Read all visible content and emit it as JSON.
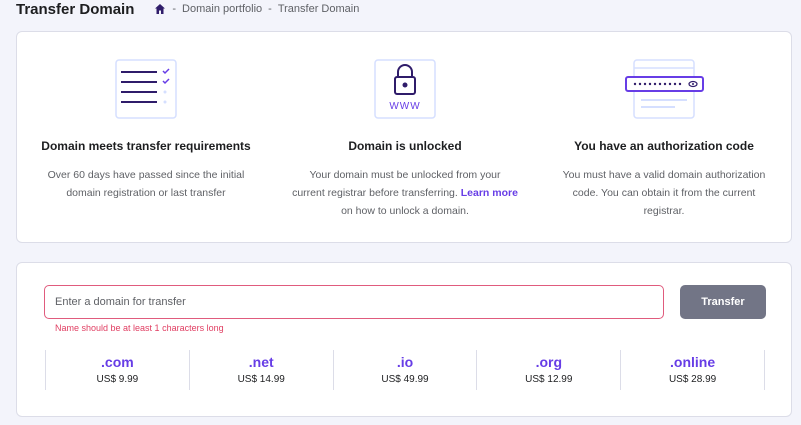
{
  "header": {
    "title": "Transfer Domain",
    "breadcrumb": [
      "Domain portfolio",
      "Transfer Domain"
    ],
    "separator": "-"
  },
  "requirements": [
    {
      "icon": "checklist-icon",
      "title": "Domain meets transfer requirements",
      "text": "Over 60 days have passed since the initial domain registration or last transfer"
    },
    {
      "icon": "padlock-www-icon",
      "title": "Domain is unlocked",
      "text_before": "Your domain must be unlocked from your current registrar before transferring. ",
      "link": "Learn more",
      "text_after": " on how to unlock a domain."
    },
    {
      "icon": "authorization-code-icon",
      "title": "You have an authorization code",
      "text": "You must have a valid domain authorization code. You can obtain it from the current registrar."
    }
  ],
  "form": {
    "placeholder": "Enter a domain for transfer",
    "value": "",
    "button": "Transfer",
    "error": "Name should be at least 1 characters long"
  },
  "tlds": [
    {
      "name": ".com",
      "price": "US$ 9.99"
    },
    {
      "name": ".net",
      "price": "US$ 14.99"
    },
    {
      "name": ".io",
      "price": "US$ 49.99"
    },
    {
      "name": ".org",
      "price": "US$ 12.99"
    },
    {
      "name": ".online",
      "price": "US$ 28.99"
    }
  ],
  "colors": {
    "accent": "#673de6",
    "error": "#e03e62",
    "button": "#727586"
  }
}
